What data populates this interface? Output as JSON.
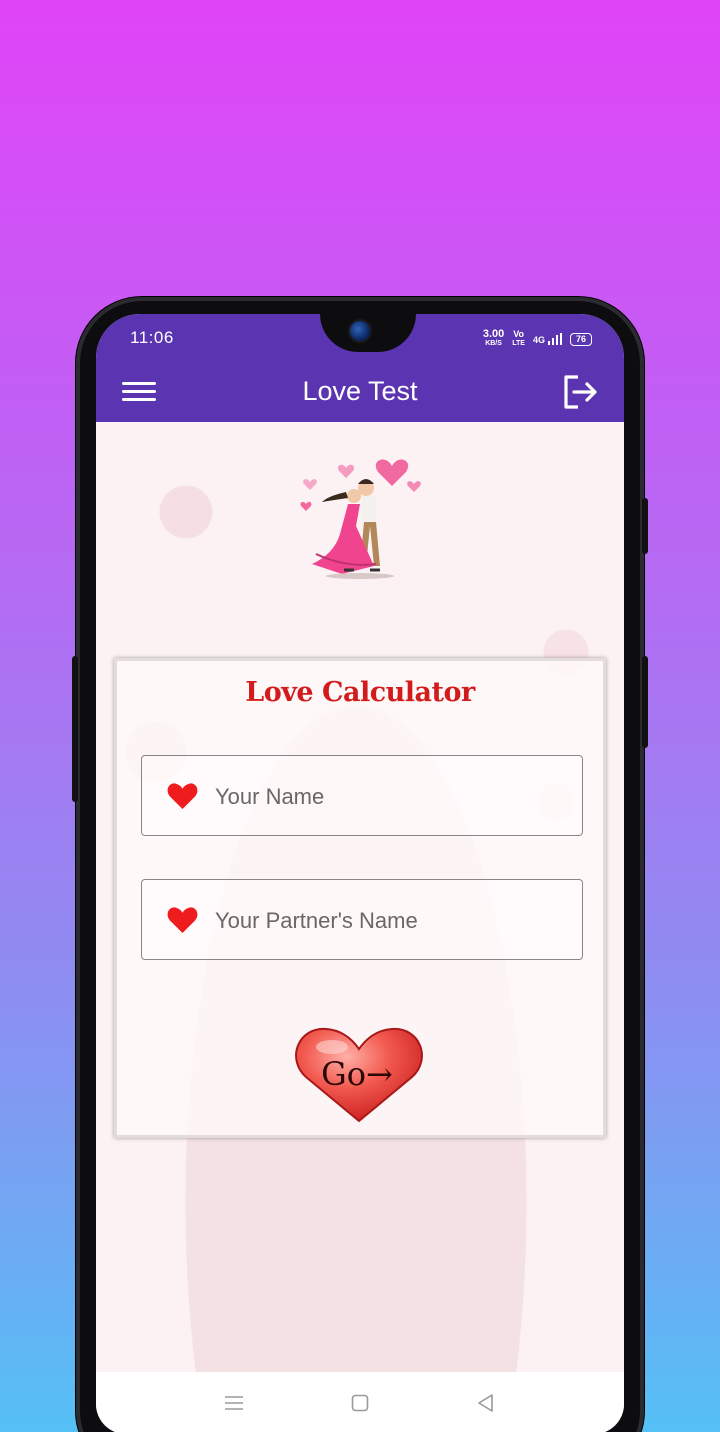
{
  "status_bar": {
    "time": "11:06",
    "net_speed_value": "3.00",
    "net_speed_unit": "KB/S",
    "volte_top": "Vo",
    "volte_bottom": "LTE",
    "network": "4G",
    "battery": "76"
  },
  "app_bar": {
    "title": "Love Test",
    "menu_icon": "hamburger-menu-icon",
    "logout_icon": "logout-icon"
  },
  "card": {
    "title": "Love Calculator",
    "fields": [
      {
        "placeholder": "Your Name",
        "icon": "heart-icon"
      },
      {
        "placeholder": "Your Partner's Name",
        "icon": "heart-icon"
      }
    ],
    "go_button": {
      "label": "Go→"
    }
  },
  "navigation": {
    "items": [
      "menu-lines-icon",
      "square-home-icon",
      "triangle-back-icon"
    ]
  },
  "colors": {
    "primary": "#5b35b1",
    "title_red": "#d21c1c",
    "heart_red": "#ee1c1c",
    "background_top": "#e044f7",
    "background_bottom": "#55c0f5"
  }
}
